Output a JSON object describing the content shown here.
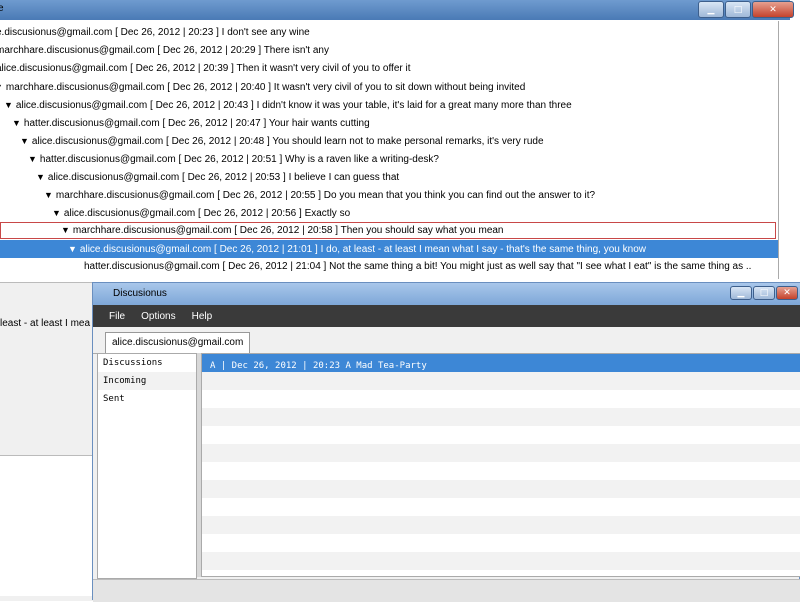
{
  "back_window": {
    "title": "e",
    "thread": [
      {
        "text": "e.discusionus@gmail.com [ Dec 26, 2012 | 20:23 ]  I don't see any wine",
        "arrow": ""
      },
      {
        "text": "marchhare.discusionus@gmail.com [ Dec 26, 2012 | 20:29 ]  There isn't any",
        "arrow": ""
      },
      {
        "text": "alice.discusionus@gmail.com [ Dec 26, 2012 | 20:39 ]  Then it wasn't very civil of you to offer it",
        "arrow": ""
      },
      {
        "text": "marchhare.discusionus@gmail.com [ Dec 26, 2012 | 20:40 ]  It wasn't very civil of you to sit down without being invited",
        "arrow": "▼"
      },
      {
        "text": "alice.discusionus@gmail.com [ Dec 26, 2012 | 20:43 ]  I didn't know it was your table, it's laid for a great many more than three",
        "arrow": "▼"
      },
      {
        "text": "hatter.discusionus@gmail.com [ Dec 26, 2012 | 20:47 ]  Your hair wants cutting",
        "arrow": "▼"
      },
      {
        "text": "alice.discusionus@gmail.com [ Dec 26, 2012 | 20:48 ]  You should learn not to make personal remarks, it's very rude",
        "arrow": "▼"
      },
      {
        "text": "hatter.discusionus@gmail.com [ Dec 26, 2012 | 20:51 ]  Why is a raven like a writing-desk?",
        "arrow": "▼"
      },
      {
        "text": "alice.discusionus@gmail.com [ Dec 26, 2012 | 20:53 ]  I believe I can guess that",
        "arrow": "▼"
      },
      {
        "text": "marchhare.discusionus@gmail.com [ Dec 26, 2012 | 20:55 ]  Do you mean that you think you can find out the answer to it?",
        "arrow": "▼"
      },
      {
        "text": "alice.discusionus@gmail.com [ Dec 26, 2012 | 20:56 ]  Exactly so",
        "arrow": "▼"
      },
      {
        "text": "marchhare.discusionus@gmail.com [ Dec 26, 2012 | 20:58 ]  Then you should say what you mean",
        "arrow": "▼"
      },
      {
        "text": "alice.discusionus@gmail.com [ Dec 26, 2012 | 21:01 ]  I do, at least - at least I mean what I say - that's the same thing, you know",
        "arrow": "▼"
      },
      {
        "text": "hatter.discusionus@gmail.com [ Dec 26, 2012 | 21:04 ]  Not the same thing a bit! You might just as well say that \"I see what I eat\" is the same thing as ..",
        "arrow": ""
      }
    ],
    "preview": "least - at least I mea"
  },
  "front_window": {
    "title": "Discusionus",
    "menu": [
      "File",
      "Options",
      "Help"
    ],
    "tab": "alice.discusionus@gmail.com",
    "folders": [
      "Discussions",
      "Incoming",
      "Sent"
    ],
    "messages": [
      "A | Dec 26, 2012 | 20:23 A Mad Tea-Party"
    ]
  }
}
